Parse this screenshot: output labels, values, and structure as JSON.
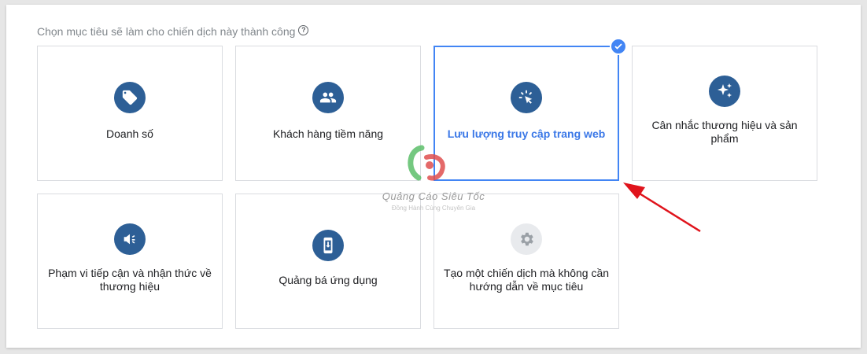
{
  "heading": "Chọn mục tiêu sẽ làm cho chiến dịch này thành công",
  "help_icon": "help-circle-icon",
  "cards": [
    {
      "label": "Doanh số",
      "icon": "tag-icon",
      "selected": false
    },
    {
      "label": "Khách hàng tiềm năng",
      "icon": "people-icon",
      "selected": false
    },
    {
      "label": "Lưu lượng truy cập trang web",
      "icon": "cursor-click-icon",
      "selected": true
    },
    {
      "label": "Cân nhắc thương hiệu và sản phẩm",
      "icon": "sparkle-icon",
      "selected": false
    },
    {
      "label": "Phạm vi tiếp cận và nhận thức về thương hiệu",
      "icon": "speaker-icon",
      "selected": false
    },
    {
      "label": "Quảng bá ứng dụng",
      "icon": "phone-download-icon",
      "selected": false
    },
    {
      "label": "Tạo một chiến dịch mà không cần hướng dẫn về mục tiêu",
      "icon": "gear-icon",
      "selected": false
    }
  ],
  "watermark": {
    "title": "Quảng Cáo Siêu Tốc",
    "subtitle": "Đồng Hành Cùng Chuyên Gia"
  },
  "colors": {
    "accent": "#4285f4",
    "icon_bg": "#2d5f96",
    "annotation_arrow": "#e0141c"
  }
}
